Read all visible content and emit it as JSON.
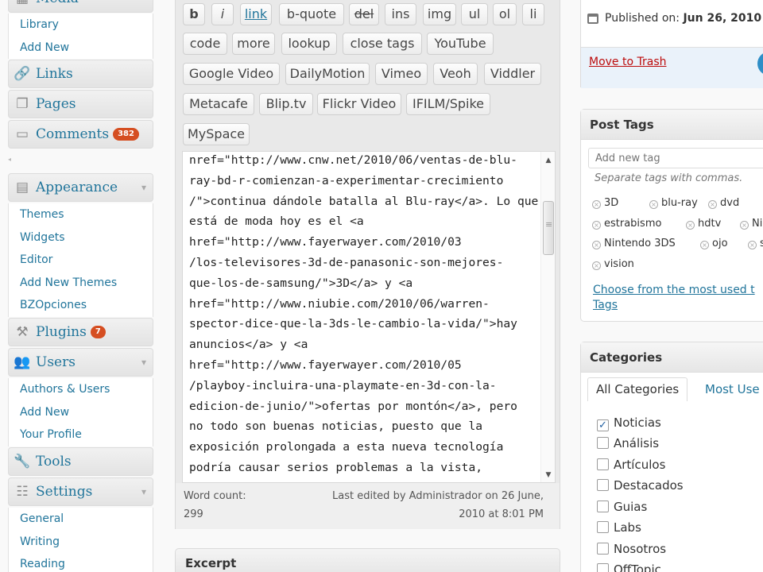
{
  "sidebar": {
    "media_partial": "Media",
    "media_items": [
      "Library",
      "Add New"
    ],
    "links": "Links",
    "pages": "Pages",
    "comments": "Comments",
    "comments_badge": "382",
    "appearance": "Appearance",
    "appearance_items": [
      "Themes",
      "Widgets",
      "Editor",
      "Add New Themes",
      "BZOpciones"
    ],
    "plugins": "Plugins",
    "plugins_badge": "7",
    "users": "Users",
    "users_items": [
      "Authors & Users",
      "Add New",
      "Your Profile"
    ],
    "tools": "Tools",
    "settings": "Settings",
    "settings_items": [
      "General",
      "Writing",
      "Reading"
    ]
  },
  "quicktags": {
    "row1": [
      "b",
      "i",
      "link",
      "b-quote",
      "del",
      "ins",
      "img",
      "ul",
      "ol",
      "li"
    ],
    "row2": [
      "code",
      "more",
      "lookup",
      "close tags",
      "YouTube"
    ],
    "row3": [
      "Google Video",
      "DailyMotion",
      "Vimeo",
      "Veoh",
      "Viddler"
    ],
    "row4": [
      "Metacafe",
      "Blip.tv",
      "Flickr Video",
      "IFILM/Spike"
    ],
    "row5": [
      "MySpace"
    ]
  },
  "editor": {
    "content": "nref=\"http://www.cnw.net/2010/06/ventas-de-blu-\nray-bd-r-comienzan-a-experimentar-crecimiento\n/\">continua dándole batalla al Blu-ray</a>. Lo que\nestá de moda hoy es el <a\nhref=\"http://www.fayerwayer.com/2010/03\n/los-televisores-3d-de-panasonic-son-mejores-\nque-los-de-samsung/\">3D</a> y <a\nhref=\"http://www.niubie.com/2010/06/warren-\nspector-dice-que-la-3ds-le-cambio-la-vida/\">hay\nanuncios</a> y <a\nhref=\"http://www.fayerwayer.com/2010/05\n/playboy-incluira-una-playmate-en-3d-con-la-\nedicion-de-junio/\">ofertas por montón</a>, pero\nno todo son buenas noticias, puesto que la\nexposición prolongada a esta nueva tecnología\npodría causar serios problemas a la vista,\nsegún reporta sciam...",
    "word_count_label": "Word count:",
    "word_count": "299",
    "last_edited_line1": "Last edited by Administrador on 26 June,",
    "last_edited_line2": "2010 at 8:01 PM"
  },
  "excerpt": {
    "title": "Excerpt"
  },
  "publish": {
    "published_label": "Published on:",
    "published_date": "Jun 26, 2010",
    "trash_link": "Move to Trash"
  },
  "post_tags": {
    "title": "Post Tags",
    "input_placeholder": "Add new tag",
    "hint": "Separate tags with commas.",
    "tags": [
      "3D",
      "blu-ray",
      "dvd",
      "estrabismo",
      "hdtv",
      "Ni",
      "Nintendo 3DS",
      "ojo",
      "s",
      "vision"
    ],
    "choose_link_line1": "Choose from the most used t",
    "choose_link_line2": "Tags"
  },
  "categories": {
    "title": "Categories",
    "tab_all": "All Categories",
    "tab_used": "Most Use",
    "items": [
      {
        "label": "Noticias",
        "checked": true
      },
      {
        "label": "Análisis",
        "checked": false
      },
      {
        "label": "Artículos",
        "checked": false
      },
      {
        "label": "Destacados",
        "checked": false
      },
      {
        "label": "Guias",
        "checked": false
      },
      {
        "label": "Labs",
        "checked": false
      },
      {
        "label": "Nosotros",
        "checked": false
      },
      {
        "label": "OffTopic",
        "checked": false
      }
    ]
  }
}
